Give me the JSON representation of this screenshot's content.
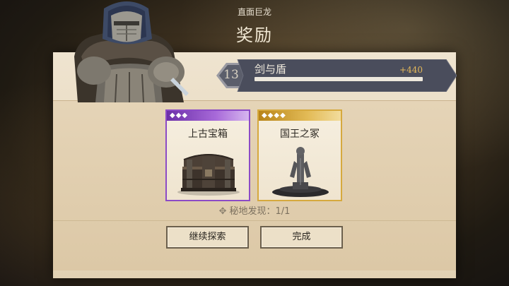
{
  "header": {
    "subtitle": "直面巨龙",
    "title": "奖励"
  },
  "achievement": {
    "level": "13",
    "name": "剑与盾",
    "exp_gain": "+440",
    "progress": 1.0
  },
  "rewards": [
    {
      "name": "上古宝箱",
      "rarity": "purple",
      "gems": "◆◆◆",
      "icon": "ancient-chest-icon"
    },
    {
      "name": "国王之冢",
      "rarity": "gold",
      "gems": "◆◆◆◆",
      "icon": "king-statue-icon"
    }
  ],
  "discovery": {
    "icon": "compass-icon",
    "text": "秘地发现：1/1"
  },
  "buttons": {
    "continue": "继续探索",
    "done": "完成"
  },
  "colors": {
    "purple_rarity": "#8c4bc6",
    "gold_rarity": "#d6a93e",
    "exp_text": "#e4b85a",
    "banner": "#4a4d5c"
  }
}
